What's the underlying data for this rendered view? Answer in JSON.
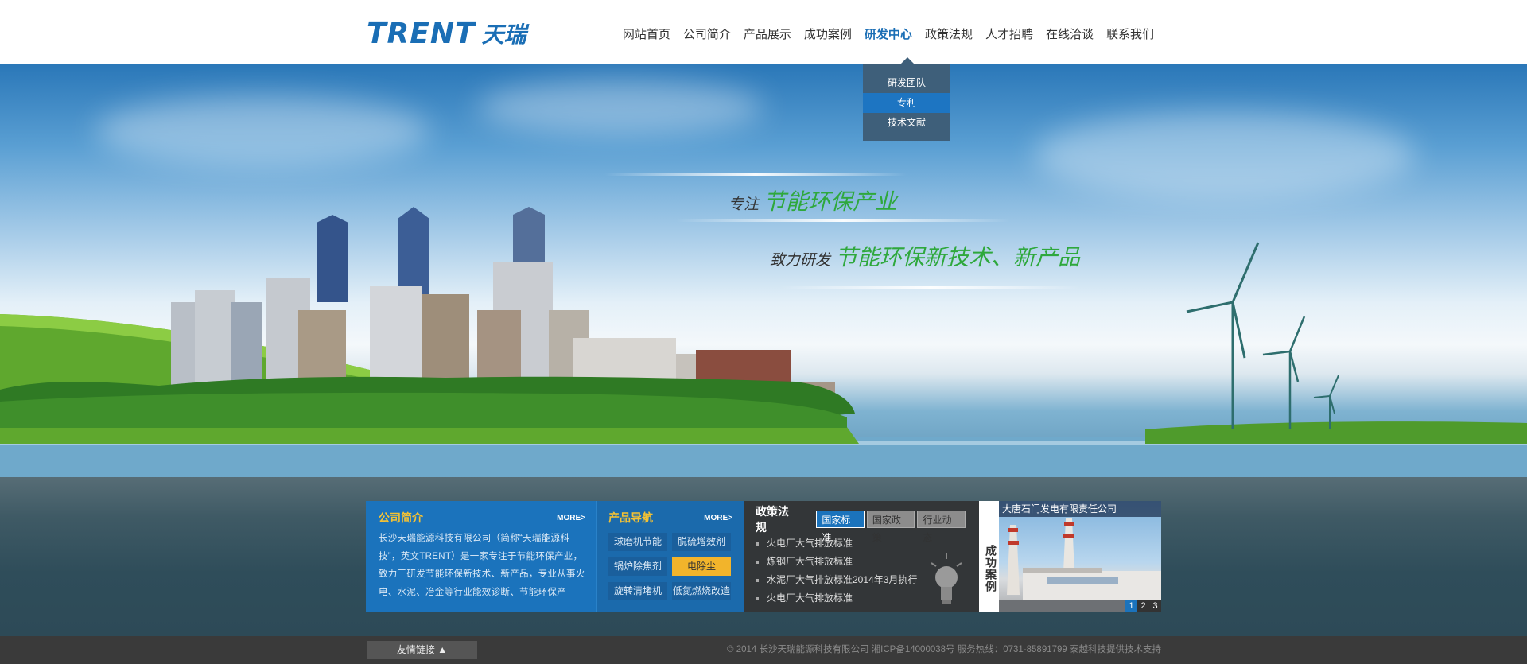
{
  "logo": {
    "en": "TRENT",
    "cn": "天瑞"
  },
  "nav": {
    "items": [
      {
        "label": "网站首页"
      },
      {
        "label": "公司简介"
      },
      {
        "label": "产品展示"
      },
      {
        "label": "成功案例"
      },
      {
        "label": "研发中心",
        "active": true
      },
      {
        "label": "政策法规"
      },
      {
        "label": "人才招聘"
      },
      {
        "label": "在线洽谈"
      },
      {
        "label": "联系我们"
      }
    ],
    "dropdown": [
      {
        "label": "研发团队"
      },
      {
        "label": "专利",
        "active": true
      },
      {
        "label": "技术文献"
      }
    ]
  },
  "banner": {
    "slogan1_prefix": "专注",
    "slogan1_main": "节能环保产业",
    "slogan2_prefix": "致力研发",
    "slogan2_main": "节能环保新技术、新产品"
  },
  "company": {
    "title": "公司简介",
    "more": "MORE>",
    "text": "长沙天瑞能源科技有限公司（简称“天瑞能源科技”，英文TRENT）是一家专注于节能环保产业，致力于研发节能环保新技术、新产品，专业从事火电、水泥、冶金等行业能效诊断、节能环保产"
  },
  "products": {
    "title": "产品导航",
    "more": "MORE>",
    "items": [
      {
        "label": "球磨机节能"
      },
      {
        "label": "脱硫增效剂"
      },
      {
        "label": "锅炉除焦剂"
      },
      {
        "label": "电除尘",
        "active": true
      },
      {
        "label": "旋转清堵机"
      },
      {
        "label": "低氮燃烧改造"
      }
    ]
  },
  "policy": {
    "title": "政策法规",
    "tabs": [
      {
        "label": "国家标准",
        "active": true
      },
      {
        "label": "国家政策"
      },
      {
        "label": "行业动态"
      }
    ],
    "items": [
      "火电厂大气排放标准",
      "炼钢厂大气排放标准",
      "水泥厂大气排放标准2014年3月执行",
      "火电厂大气排放标准"
    ]
  },
  "cases": {
    "label": "成功案例",
    "caption": "大唐石门发电有限责任公司",
    "pages": [
      "1",
      "2",
      "3"
    ],
    "active_page": "1"
  },
  "footer": {
    "links_label": "友情链接 ▲",
    "copyright": "© 2014  长沙天瑞能源科技有限公司  湘ICP备14000038号  服务热线：0731-85891799  泰越科技提供技术支持"
  }
}
